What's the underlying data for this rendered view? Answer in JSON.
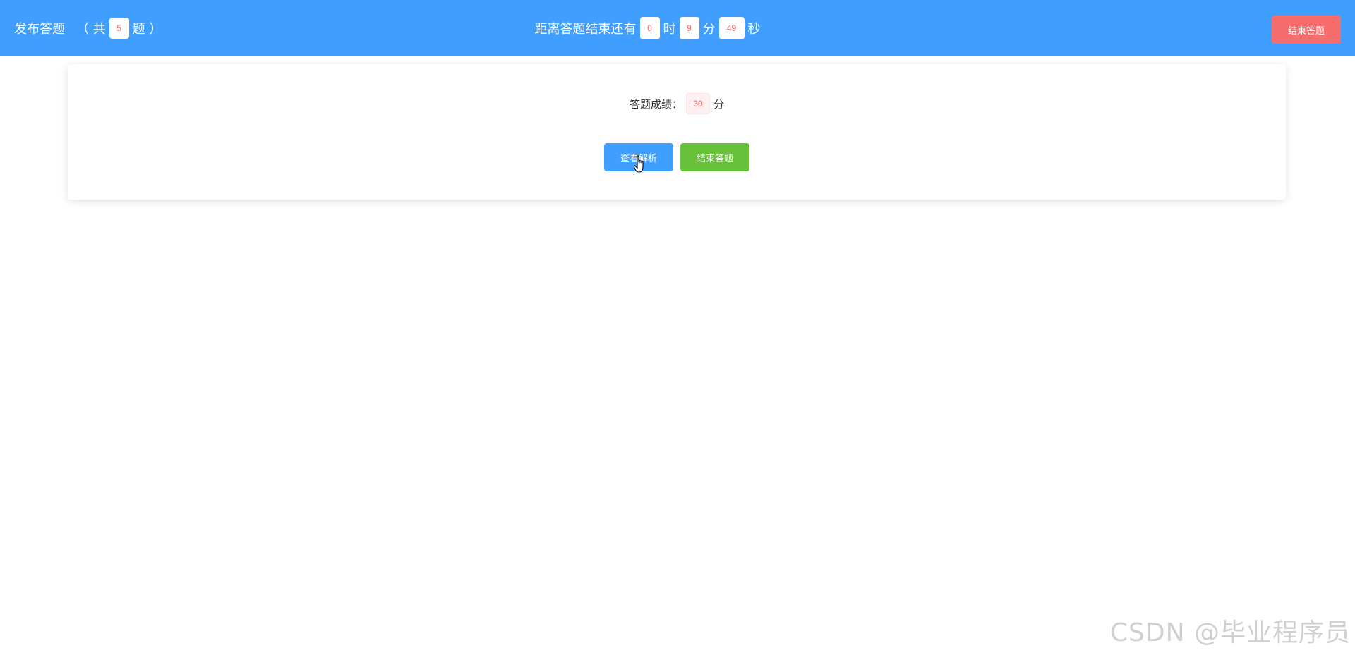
{
  "header": {
    "title": "发布答题",
    "count_prefix": "（ 共",
    "question_count": "5",
    "count_suffix": "题 ）",
    "countdown_label": "距离答题结束还有",
    "hours": "0",
    "hours_unit": "时",
    "minutes": "9",
    "minutes_unit": "分",
    "seconds": "49",
    "seconds_unit": "秒",
    "end_button": "结束答题"
  },
  "result": {
    "score_label": "答题成绩：",
    "score": "30",
    "score_unit": "分",
    "view_analysis_button": "查看解析",
    "end_button": "结束答题"
  },
  "watermark": "CSDN @毕业程序员",
  "colors": {
    "primary": "#409eff",
    "danger": "#f56c6c",
    "success": "#67c23a"
  }
}
